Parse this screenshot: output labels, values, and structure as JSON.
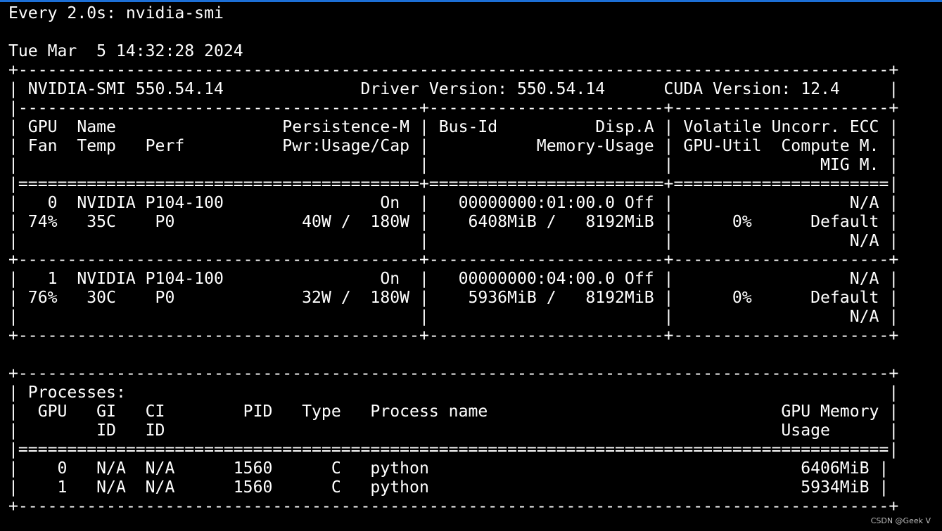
{
  "terminal": {
    "lines": [
      "Every 2.0s: nvidia-smi",
      "",
      "Tue Mar  5 14:32:28 2024",
      "+-----------------------------------------------------------------------------------------+",
      "| NVIDIA-SMI 550.54.14              Driver Version: 550.54.14      CUDA Version: 12.4     |",
      "|-----------------------------------------+------------------------+----------------------+",
      "| GPU  Name                 Persistence-M | Bus-Id          Disp.A | Volatile Uncorr. ECC |",
      "| Fan  Temp   Perf          Pwr:Usage/Cap |           Memory-Usage | GPU-Util  Compute M. |",
      "|                                         |                        |               MIG M. |",
      "|=========================================+========================+======================|",
      "|   0  NVIDIA P104-100                On  |   00000000:01:00.0 Off |                  N/A |",
      "| 74%   35C    P0             40W /  180W |    6408MiB /   8192MiB |      0%      Default |",
      "|                                         |                        |                  N/A |",
      "+-----------------------------------------+------------------------+----------------------+",
      "|   1  NVIDIA P104-100                On  |   00000000:04:00.0 Off |                  N/A |",
      "| 76%   30C    P0             32W /  180W |    5936MiB /   8192MiB |      0%      Default |",
      "|                                         |                        |                  N/A |",
      "+-----------------------------------------+------------------------+----------------------+",
      "",
      "+-----------------------------------------------------------------------------------------+",
      "| Processes:                                                                              |",
      "|  GPU   GI   CI        PID   Type   Process name                              GPU Memory |",
      "|        ID   ID                                                               Usage      |",
      "|=========================================================================================|",
      "|    0   N/A  N/A      1560      C   python                                      6406MiB |",
      "|    1   N/A  N/A      1560      C   python                                      5934MiB |",
      "+-----------------------------------------------------------------------------------------+"
    ]
  },
  "watermark": "CSDN @Geek V",
  "colors": {
    "background": "#000000",
    "text": "#ffffff",
    "window_top_border": "#1c6fd6",
    "watermark": "#bdbdbd"
  }
}
